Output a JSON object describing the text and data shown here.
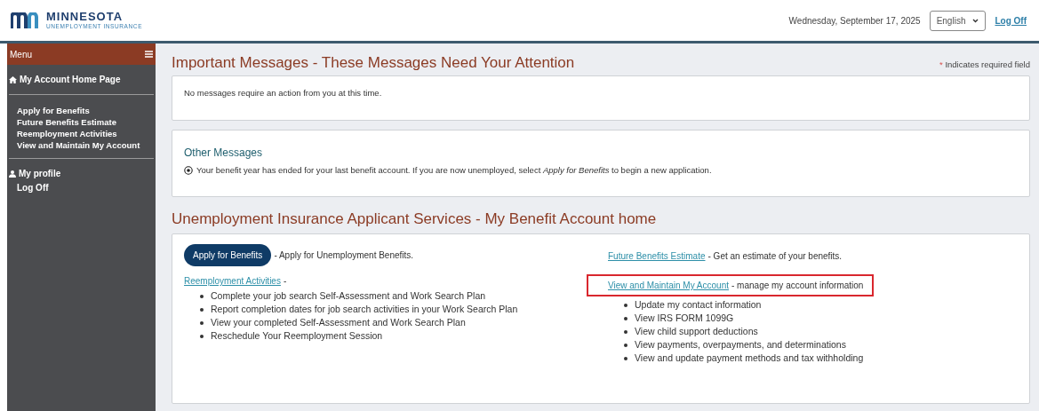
{
  "header": {
    "logo": {
      "title": "MINNESOTA",
      "subtitle": "UNEMPLOYMENT INSURANCE"
    },
    "date": "Wednesday, September 17, 2025",
    "language": "English",
    "logoff": "Log Off"
  },
  "sidebar": {
    "menu_label": "Menu",
    "home": "My Account Home Page",
    "links": [
      "Apply for Benefits",
      "Future Benefits Estimate",
      "Reemployment Activities",
      "View and Maintain My Account"
    ],
    "profile": "My profile",
    "logoff": "Log Off"
  },
  "main": {
    "required_note": {
      "mark": "*",
      "text": "Indicates required field"
    },
    "important": {
      "title": "Important Messages - These Messages Need Your Attention",
      "message": "No messages require an action from you at this time."
    },
    "other_messages": {
      "title": "Other Messages",
      "items": [
        "Your benefit year has ended for your last benefit account. If you are now unemployed, select *Apply for Benefits* to begin a new application."
      ]
    },
    "services": {
      "title": "Unemployment Insurance Applicant Services - My Benefit Account home",
      "apply": {
        "button": "Apply for Benefits",
        "description": "- Apply for Unemployment Benefits."
      },
      "reemployment": {
        "link": "Reemployment Activities",
        "suffix": "-",
        "bullets": [
          "Complete your job search Self-Assessment and Work Search Plan",
          "Report completion dates for job search activities in your Work Search Plan",
          "View your completed Self-Assessment and Work Search Plan",
          "Reschedule Your Reemployment Session"
        ]
      },
      "estimate": {
        "link": "Future Benefits Estimate",
        "description": "- Get an estimate of your benefits."
      },
      "account": {
        "link": "View and Maintain My Account",
        "description": "- manage my account information",
        "highlighted": true,
        "bullets": [
          "Update my contact information",
          "View IRS FORM 1099G",
          "View child support deductions",
          "View payments, overpayments, and determinations",
          "View and update payment methods and tax withholding"
        ]
      }
    }
  }
}
